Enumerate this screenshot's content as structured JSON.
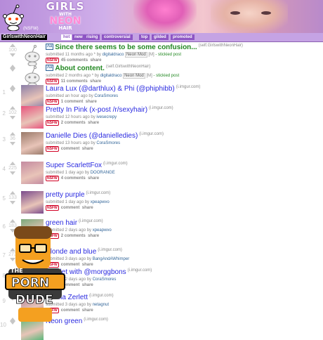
{
  "header": {
    "logo_line1": "GIRLS",
    "logo_line2": "WITH",
    "logo_line3": "NEON",
    "logo_line4": "HAIR",
    "nsfw_label": "(NSFW)"
  },
  "tabbar": {
    "subreddit_name": "GirlswithNeonHair",
    "tabs": [
      {
        "label": "hot",
        "selected": true
      },
      {
        "label": "new",
        "selected": false
      },
      {
        "label": "rising",
        "selected": false
      },
      {
        "label": "controversial",
        "selected": false
      },
      {
        "label": "top",
        "selected": false
      },
      {
        "label": "gilded",
        "selected": false
      },
      {
        "label": "promoted",
        "selected": false
      }
    ]
  },
  "posts": [
    {
      "rank": "",
      "score": "100",
      "title": "Since there seems to be some confusion...",
      "domain": "(self.GirlswithNeonHair)",
      "tagline_pre": "submitted 11 months ago * by",
      "author": "digitaldraco",
      "flair": "Neon Mod",
      "mod": "[M]",
      "stickied": "- stickied post",
      "nsfw": "NSFW",
      "comments": "45 comments",
      "share": "share",
      "sticky": true,
      "self": true,
      "thumb_color": ""
    },
    {
      "rank": "",
      "score": "",
      "title": "About content.",
      "domain": "(self.GirlswithNeonHair)",
      "tagline_pre": "submitted 2 months ago * by",
      "author": "digitaldraco",
      "flair": "Neon Mod",
      "mod": "[M]",
      "stickied": "- stickied post",
      "nsfw": "NSFW",
      "comments": "11 comments",
      "share": "share",
      "sticky": true,
      "self": true,
      "thumb_color": ""
    },
    {
      "rank": "1",
      "score": "",
      "title": "Laura Lux (@darthlux) & Phi (@phiphibb)",
      "domain": "(i.imgur.com)",
      "tagline_pre": "submitted an hour ago by",
      "author": "CoraSmores",
      "flair": "",
      "mod": "",
      "stickied": "",
      "nsfw": "NSFW",
      "comments": "1 comment",
      "share": "share",
      "sticky": false,
      "self": false,
      "thumb_color": "#8b7fa8"
    },
    {
      "rank": "2",
      "score": "102",
      "title": "Pretty In Pink (x-post /r/sexyhair)",
      "domain": "(i.imgur.com)",
      "tagline_pre": "submitted 12 hours ago by",
      "author": "ivesecrepy",
      "flair": "",
      "mod": "",
      "stickied": "",
      "nsfw": "NSFW",
      "comments": "2 comments",
      "share": "share",
      "sticky": false,
      "self": false,
      "thumb_color": "#e8537d"
    },
    {
      "rank": "3",
      "score": "36",
      "title": "Danielle Dies (@danielledies)",
      "domain": "(i.imgur.com)",
      "tagline_pre": "submitted 13 hours ago by",
      "author": "CoraSmores",
      "flair": "",
      "mod": "",
      "stickied": "",
      "nsfw": "NSFW",
      "comments": "comment",
      "share": "share",
      "sticky": false,
      "self": false,
      "thumb_color": "#9a7a6a"
    },
    {
      "rank": "4",
      "score": "225",
      "title": "Super ScarlettFox",
      "domain": "(i.imgur.com)",
      "tagline_pre": "submitted 1 day ago by",
      "author": "DOORANGE",
      "flair": "",
      "mod": "",
      "stickied": "",
      "nsfw": "NSFW",
      "comments": "4 comments",
      "share": "share",
      "sticky": false,
      "self": false,
      "thumb_color": "#c48aa0"
    },
    {
      "rank": "5",
      "score": "133",
      "title": "pretty purple",
      "domain": "(i.imgur.com)",
      "tagline_pre": "submitted 1 day ago by",
      "author": "xpeapwvo",
      "flair": "",
      "mod": "",
      "stickied": "",
      "nsfw": "NSFW",
      "comments": "comment",
      "share": "share",
      "sticky": false,
      "self": false,
      "thumb_color": "#7a4a8c"
    },
    {
      "rank": "6",
      "score": "183",
      "title": "green hair",
      "domain": "(i.imgur.com)",
      "tagline_pre": "submitted 2 days ago by",
      "author": "xpeapwvo",
      "flair": "",
      "mod": "",
      "stickied": "",
      "nsfw": "NSFW",
      "comments": "2 comments",
      "share": "share",
      "sticky": false,
      "self": false,
      "thumb_color": "#7aa87a"
    },
    {
      "rank": "7",
      "score": "273",
      "title": "Blonde and blue",
      "domain": "(i.imgur.com)",
      "tagline_pre": "submitted 3 days ago by",
      "author": "BangAndAWhimper",
      "flair": "",
      "mod": "",
      "stickied": "",
      "nsfw": "NSFW",
      "comments": "comment",
      "share": "share",
      "sticky": false,
      "self": false,
      "thumb_color": "#6a8ac0"
    },
    {
      "rank": "8",
      "score": "",
      "title": "Scarlet with @morggbons",
      "domain": "(i.imgur.com)",
      "tagline_pre": "submitted 2 days ago by",
      "author": "CoraSmores",
      "flair": "",
      "mod": "",
      "stickied": "",
      "nsfw": "NSFW",
      "comments": "comment",
      "share": "share",
      "sticky": false,
      "self": false,
      "thumb_color": "#b85a5a"
    },
    {
      "rank": "9",
      "score": "",
      "title": "Emma Zerlett",
      "domain": "(i.imgur.com)",
      "tagline_pre": "submitted 3 days ago by",
      "author": "netagnut",
      "flair": "",
      "mod": "",
      "stickied": "",
      "nsfw": "NSFW",
      "comments": "comment",
      "share": "share",
      "sticky": false,
      "self": false,
      "thumb_color": "#a0708c"
    },
    {
      "rank": "10",
      "score": "",
      "title": "Neon green",
      "domain": "(i.imgur.com)",
      "tagline_pre": "",
      "author": "",
      "flair": "",
      "mod": "",
      "stickied": "",
      "nsfw": "",
      "comments": "",
      "share": "",
      "sticky": false,
      "self": false,
      "thumb_color": "#5ab87a"
    }
  ],
  "badge": {
    "line1": "THE",
    "line2": "PORN",
    "line3": "DUDE"
  },
  "colors": {
    "header_bg": "#c9a5e6",
    "tab_bg": "#8e56c4",
    "title_link": "#2a2ae0",
    "sticky_title": "#228822",
    "nsfw": "#d10023"
  }
}
